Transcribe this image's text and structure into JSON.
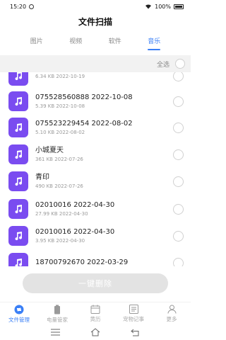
{
  "status_bar": {
    "time": "15:20",
    "battery": "100%"
  },
  "title": "文件扫描",
  "tabs": [
    {
      "label": "图片",
      "active": false
    },
    {
      "label": "视频",
      "active": false
    },
    {
      "label": "软件",
      "active": false
    },
    {
      "label": "音乐",
      "active": true
    }
  ],
  "select_all_label": "全选",
  "files": [
    {
      "name": "",
      "meta": "6.34 KB  2022-10-19"
    },
    {
      "name": "075528560888  2022-10-08",
      "meta": "5.39 KB  2022-10-08"
    },
    {
      "name": "075523229454  2022-08-02",
      "meta": "5.10 KB  2022-08-02"
    },
    {
      "name": "小城夏天",
      "meta": "361 KB  2022-07-26"
    },
    {
      "name": "青印",
      "meta": "490 KB  2022-07-26"
    },
    {
      "name": "02010016  2022-04-30",
      "meta": "27.99 KB  2022-04-30"
    },
    {
      "name": "02010016  2022-04-30",
      "meta": "3.95 KB  2022-04-30"
    },
    {
      "name": "18700792670  2022-03-29",
      "meta": ""
    }
  ],
  "delete_button_label": "一键删除",
  "bottom_nav": [
    {
      "label": "文件管理",
      "icon": "file-manager-icon",
      "active": true
    },
    {
      "label": "电量管家",
      "icon": "battery-manager-icon",
      "active": false
    },
    {
      "label": "黄历",
      "icon": "calendar-icon",
      "active": false
    },
    {
      "label": "宠物记事",
      "icon": "notes-icon",
      "active": false
    },
    {
      "label": "更多",
      "icon": "profile-icon",
      "active": false
    }
  ],
  "colors": {
    "accent": "#3a7ff6",
    "music_icon_bg": "#7a4cf0"
  }
}
